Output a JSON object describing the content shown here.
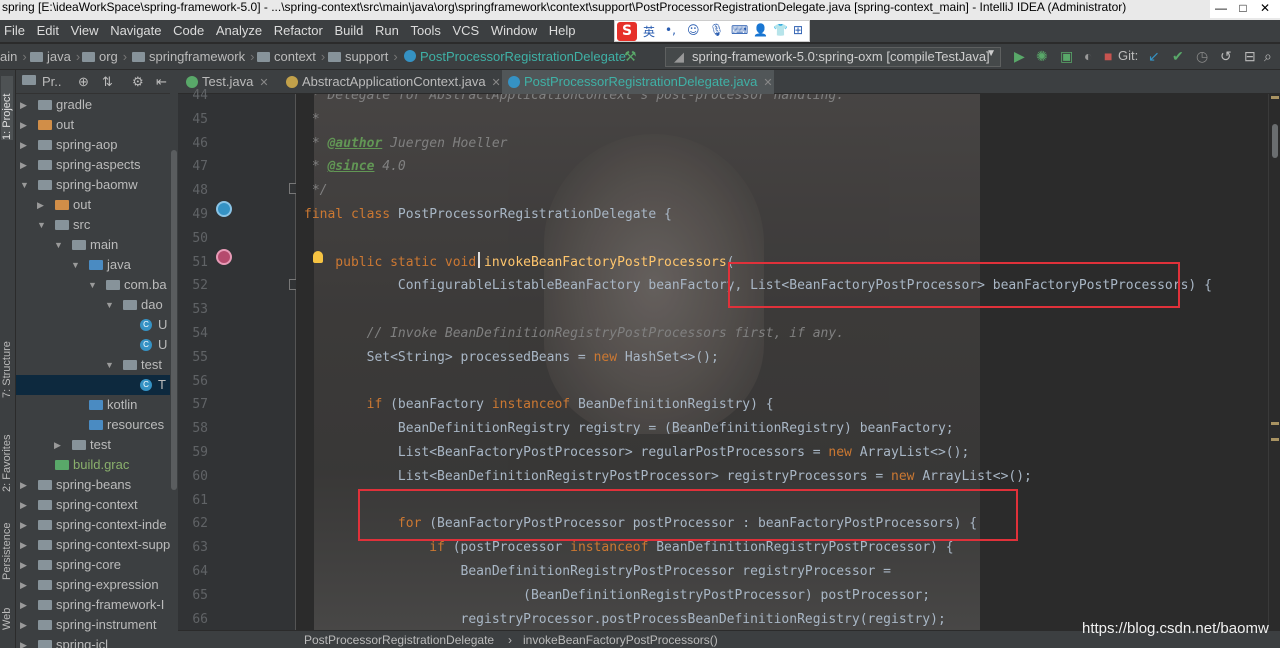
{
  "window": {
    "title": "spring [E:\\ideaWorkSpace\\spring-framework-5.0] - ...\\spring-context\\src\\main\\java\\org\\springframework\\context\\support\\PostProcessorRegistrationDelegate.java [spring-context_main] - IntelliJ IDEA (Administrator)",
    "controls": [
      "—",
      "□",
      "✕"
    ]
  },
  "menu": [
    "File",
    "Edit",
    "View",
    "Navigate",
    "Code",
    "Analyze",
    "Refactor",
    "Build",
    "Run",
    "Tools",
    "VCS",
    "Window",
    "Help"
  ],
  "ime": {
    "logo": "S",
    "mode": "英",
    "items": [
      "•,",
      "☺",
      "🎙",
      "⌨",
      "👤",
      "👕",
      "⊞"
    ]
  },
  "breadcrumbs": [
    "ain",
    "java",
    "org",
    "springframework",
    "context",
    "support",
    "PostProcessorRegistrationDelegate"
  ],
  "run_config": "spring-framework-5.0:spring-oxm [compileTestJava]",
  "toolbar": {
    "git_label": "Git:"
  },
  "left_tool_tabs": [
    "1: Project",
    "7: Structure",
    "2: Favorites",
    "Persistence",
    "Web"
  ],
  "project_panel": {
    "title": "Pr..",
    "tree": [
      {
        "label": "gradle",
        "icon": "gray",
        "arrow": "▶",
        "indent": 0
      },
      {
        "label": "out",
        "icon": "orange",
        "arrow": "▶",
        "indent": 0
      },
      {
        "label": "spring-aop",
        "icon": "gray",
        "arrow": "▶",
        "indent": 0
      },
      {
        "label": "spring-aspects",
        "icon": "gray",
        "arrow": "▶",
        "indent": 0
      },
      {
        "label": "spring-baomw",
        "icon": "gray",
        "arrow": "▼",
        "indent": 0
      },
      {
        "label": "out",
        "icon": "orange",
        "arrow": "▶",
        "indent": 1
      },
      {
        "label": "src",
        "icon": "gray",
        "arrow": "▼",
        "indent": 1
      },
      {
        "label": "main",
        "icon": "gray",
        "arrow": "▼",
        "indent": 2
      },
      {
        "label": "java",
        "icon": "blue",
        "arrow": "▼",
        "indent": 3
      },
      {
        "label": "com.ba",
        "icon": "gray",
        "arrow": "▼",
        "indent": 4
      },
      {
        "label": "dao",
        "icon": "gray",
        "arrow": "▼",
        "indent": 5
      },
      {
        "label": "U",
        "icon": "class",
        "arrow": "",
        "indent": 6
      },
      {
        "label": "U",
        "icon": "class",
        "arrow": "",
        "indent": 6
      },
      {
        "label": "test",
        "icon": "gray",
        "arrow": "▼",
        "indent": 5
      },
      {
        "label": "T",
        "icon": "class",
        "arrow": "",
        "indent": 6,
        "selected": true
      },
      {
        "label": "kotlin",
        "icon": "blue",
        "arrow": "",
        "indent": 3
      },
      {
        "label": "resources",
        "icon": "blue",
        "arrow": "",
        "indent": 3
      },
      {
        "label": "test",
        "icon": "gray",
        "arrow": "▶",
        "indent": 2
      },
      {
        "label": "build.grac",
        "icon": "green",
        "arrow": "",
        "indent": 1
      },
      {
        "label": "spring-beans",
        "icon": "gray",
        "arrow": "▶",
        "indent": 0
      },
      {
        "label": "spring-context",
        "icon": "gray",
        "arrow": "▶",
        "indent": 0
      },
      {
        "label": "spring-context-inde",
        "icon": "gray",
        "arrow": "▶",
        "indent": 0
      },
      {
        "label": "spring-context-supp",
        "icon": "gray",
        "arrow": "▶",
        "indent": 0
      },
      {
        "label": "spring-core",
        "icon": "gray",
        "arrow": "▶",
        "indent": 0
      },
      {
        "label": "spring-expression",
        "icon": "gray",
        "arrow": "▶",
        "indent": 0
      },
      {
        "label": "spring-framework-I",
        "icon": "gray",
        "arrow": "▶",
        "indent": 0
      },
      {
        "label": "spring-instrument",
        "icon": "gray",
        "arrow": "▶",
        "indent": 0
      },
      {
        "label": "spring-jcl",
        "icon": "gray",
        "arrow": "▶",
        "indent": 0
      }
    ]
  },
  "editor_tabs": [
    {
      "label": "Test.java",
      "active": false
    },
    {
      "label": "AbstractApplicationContext.java",
      "active": false
    },
    {
      "label": "PostProcessorRegistrationDelegate.java",
      "active": true
    }
  ],
  "line_numbers": [
    "44",
    "45",
    "46",
    "47",
    "48",
    "49",
    "50",
    "51",
    "52",
    "53",
    "54",
    "55",
    "56",
    "57",
    "58",
    "59",
    "60",
    "61",
    "62",
    "63",
    "64",
    "65",
    "66"
  ],
  "code_lines": [
    [
      {
        "t": " * Delegate for AbstractApplicationContext's post-processor handling.",
        "c": "cm"
      }
    ],
    [
      {
        "t": " *",
        "c": "cm"
      }
    ],
    [
      {
        "t": " * ",
        "c": "cm"
      },
      {
        "t": "@author",
        "c": "tag"
      },
      {
        "t": " Juergen Hoeller",
        "c": "cm"
      }
    ],
    [
      {
        "t": " * ",
        "c": "cm"
      },
      {
        "t": "@since",
        "c": "tag"
      },
      {
        "t": " 4.0",
        "c": "cm"
      }
    ],
    [
      {
        "t": " */",
        "c": "cm"
      }
    ],
    [
      {
        "t": "final class ",
        "c": "kw"
      },
      {
        "t": "PostProcessorRegistrationDelegate {",
        "c": "ident"
      }
    ],
    [],
    [
      {
        "t": "    public static void ",
        "c": "kw"
      },
      {
        "t": "invokeBeanFactoryPostProcessors",
        "c": "fn"
      },
      {
        "t": "(",
        "c": "ident"
      }
    ],
    [
      {
        "t": "            ConfigurableListableBeanFactory beanFactory, List<BeanFactoryPostProcessor> beanFactoryPostProcessors) {",
        "c": "ident"
      }
    ],
    [],
    [
      {
        "t": "        // Invoke BeanDefinitionRegistryPostProcessors first, if any.",
        "c": "cm"
      }
    ],
    [
      {
        "t": "        Set<String> processedBeans = ",
        "c": "ident"
      },
      {
        "t": "new ",
        "c": "kw"
      },
      {
        "t": "HashSet<>();",
        "c": "ident"
      }
    ],
    [],
    [
      {
        "t": "        if ",
        "c": "kw"
      },
      {
        "t": "(beanFactory ",
        "c": "ident"
      },
      {
        "t": "instanceof ",
        "c": "kw"
      },
      {
        "t": "BeanDefinitionRegistry) {",
        "c": "ident"
      }
    ],
    [
      {
        "t": "            BeanDefinitionRegistry registry = (BeanDefinitionRegistry) beanFactory;",
        "c": "ident"
      }
    ],
    [
      {
        "t": "            List<BeanFactoryPostProcessor> regularPostProcessors = ",
        "c": "ident"
      },
      {
        "t": "new ",
        "c": "kw"
      },
      {
        "t": "ArrayList<>();",
        "c": "ident"
      }
    ],
    [
      {
        "t": "            List<BeanDefinitionRegistryPostProcessor> registryProcessors = ",
        "c": "ident"
      },
      {
        "t": "new ",
        "c": "kw"
      },
      {
        "t": "ArrayList<>();",
        "c": "ident"
      }
    ],
    [],
    [
      {
        "t": "            for ",
        "c": "kw"
      },
      {
        "t": "(BeanFactoryPostProcessor postProcessor : beanFactoryPostProcessors) {",
        "c": "ident"
      }
    ],
    [
      {
        "t": "                if ",
        "c": "kw"
      },
      {
        "t": "(postProcessor ",
        "c": "ident"
      },
      {
        "t": "instanceof ",
        "c": "kw"
      },
      {
        "t": "BeanDefinitionRegistryPostProcessor) {",
        "c": "ident"
      }
    ],
    [
      {
        "t": "                    BeanDefinitionRegistryPostProcessor registryProcessor =",
        "c": "ident"
      }
    ],
    [
      {
        "t": "                            (BeanDefinitionRegistryPostProcessor) postProcessor;",
        "c": "ident"
      }
    ],
    [
      {
        "t": "                    registryProcessor.postProcessBeanDefinitionRegistry(registry);",
        "c": "ident"
      }
    ]
  ],
  "footer_breadcrumb": [
    "PostProcessorRegistrationDelegate",
    "invokeBeanFactoryPostProcessors()"
  ],
  "watermark": "https://blog.csdn.net/baomw",
  "colors": {
    "keyword": "#cc7832",
    "comment": "#808080",
    "method": "#ffc66d",
    "highlight_box": "#e0313a",
    "active_tab_text": "#3fb1a6"
  }
}
